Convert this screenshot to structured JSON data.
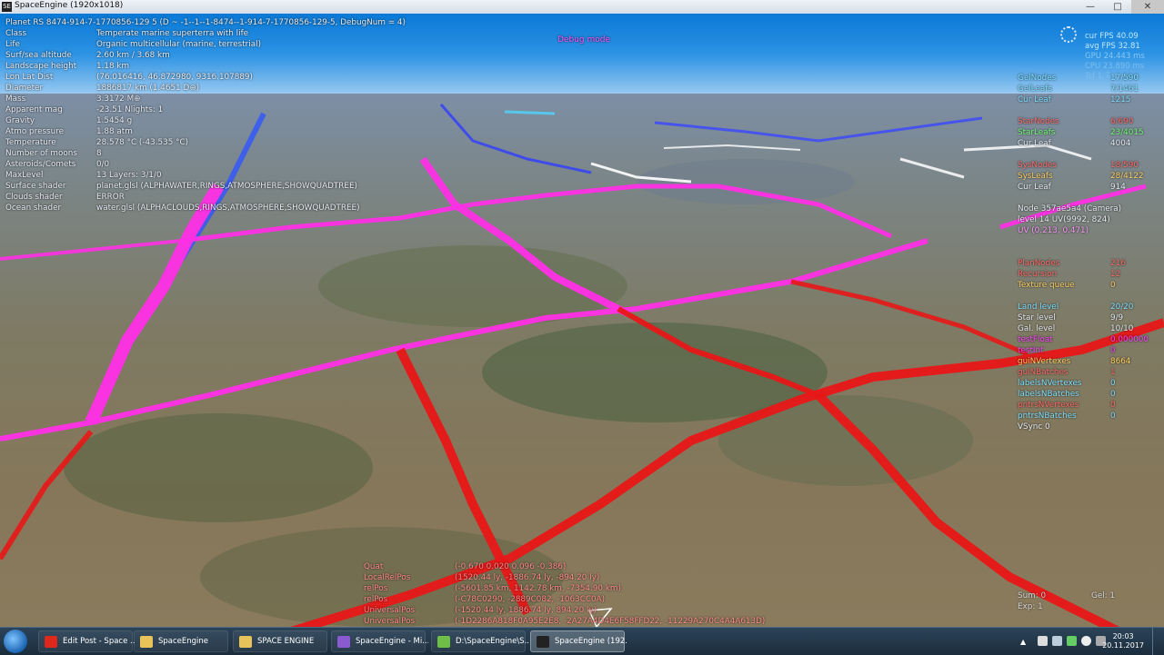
{
  "window": {
    "title": "SpaceEngine (1920x1018)",
    "app_icon": "SE"
  },
  "hud_left": {
    "planet_line": "Planet  RS 8474-914-7-1770856-129 5  (D ~ -1--1--1-8474--1-914-7-1770856-129-5, DebugNum = 4)",
    "rows": [
      {
        "label": "Class",
        "value": "Temperate marine superterra with life"
      },
      {
        "label": "Life",
        "value": "Organic multicellular (marine, terrestrial)"
      },
      {
        "label": "Surf/sea altitude",
        "value": "2.60 km / 3.68 km"
      },
      {
        "label": "Landscape height",
        "value": "1.18 km"
      },
      {
        "label": "Lon Lat Dist",
        "value": "(76.016416, 46.872980, 9316.107889)"
      },
      {
        "label": "Diameter",
        "value": "1886817 km (1.4651 D⊕)"
      },
      {
        "label": "Mass",
        "value": "3.3172 M⊕"
      },
      {
        "label": "Apparent mag",
        "value": "-23.51   Nlights: 1"
      },
      {
        "label": "Gravity",
        "value": "1.5454 g"
      },
      {
        "label": "Atmo pressure",
        "value": "1.88 atm"
      },
      {
        "label": "Temperature",
        "value": "28.578 °C (-43.535 °C)"
      },
      {
        "label": "Number of moons",
        "value": "8"
      },
      {
        "label": "Asteroids/Comets",
        "value": "0/0"
      },
      {
        "label": "MaxLevel",
        "value": "13   Layers: 3/1/0"
      },
      {
        "label": "Surface shader",
        "value": "planet.glsl (ALPHAWATER,RINGS,ATMOSPHERE,SHOWQUADTREE)"
      },
      {
        "label": "Clouds shader",
        "value": "ERROR"
      },
      {
        "label": "Ocean shader",
        "value": "water.glsl (ALPHACLOUDS,RINGS,ATMOSPHERE,SHOWQUADTREE)"
      }
    ]
  },
  "debug_label": "Debug mode",
  "fps": {
    "lines": [
      "cur FPS 40.09",
      "avg FPS 32.81",
      "GPU 24.443 ms",
      "CPU 23.890 ms",
      "Tsf 1.7 ms"
    ]
  },
  "hud_right": {
    "group1": [
      {
        "label": "GelNodes",
        "value": "17/590",
        "color": "#7fe0ff"
      },
      {
        "label": "GelLeafs",
        "value": "7/1461",
        "color": "#7fe0ff"
      },
      {
        "label": "Cur Leaf",
        "value": "1215",
        "color": "#7fe0ff"
      }
    ],
    "group2": [
      {
        "label": "StarNodes",
        "value": "6/690",
        "color": "#ff6a6a"
      },
      {
        "label": "StarLeafs",
        "value": "23/4015",
        "color": "#76ff76"
      },
      {
        "label": "Cur Leaf",
        "value": "4004",
        "color": "#e8ecf4"
      }
    ],
    "group3": [
      {
        "label": "SysNodes",
        "value": "18/590",
        "color": "#ff6a6a"
      },
      {
        "label": "SysLeafs",
        "value": "28/4122",
        "color": "#ffd166"
      },
      {
        "label": "Cur Leaf",
        "value": "914",
        "color": "#e8ecf4"
      }
    ],
    "node_info": [
      "Node 357ae5a4 (Camera)",
      "level 14 UV(9992, 824)",
      "UV (0.213, 0.471)"
    ],
    "group4": [
      {
        "label": "PlanNodes",
        "value": "216",
        "color": "#ff6a6a"
      },
      {
        "label": "Recursion",
        "value": "12",
        "color": "#ff6a6a"
      },
      {
        "label": "Texture queue",
        "value": "0",
        "color": "#ffd166"
      }
    ],
    "group5": [
      {
        "label": "Land level",
        "value": "20/20",
        "color": "#7fe0ff"
      },
      {
        "label": "Star level",
        "value": "9/9",
        "color": "#e8ecf4"
      },
      {
        "label": "Gal. level",
        "value": "10/10",
        "color": "#e8ecf4"
      },
      {
        "label": "testFloat",
        "value": "0.000000",
        "color": "#ff44ff"
      },
      {
        "label": "testInt",
        "value": "0",
        "color": "#ff44ff"
      },
      {
        "label": "guiNVertexes",
        "value": "8664",
        "color": "#ffd166"
      },
      {
        "label": "guiNBatches",
        "value": "1",
        "color": "#ff6a6a"
      },
      {
        "label": "labelsNVertexes",
        "value": "0",
        "color": "#7fe0ff"
      },
      {
        "label": "labelsNBatches",
        "value": "0",
        "color": "#7fe0ff"
      },
      {
        "label": "pntrsNVertexes",
        "value": "0",
        "color": "#ff6a6a"
      },
      {
        "label": "pntrsNBatches",
        "value": "0",
        "color": "#7fe0ff"
      }
    ],
    "vsync": "VSync 0"
  },
  "hud_bottom": {
    "rows": [
      {
        "label": "Quat",
        "value": "(-0.670  0.020  0.096  -0.386)"
      },
      {
        "label": "LocalRelPos",
        "value": "(1520.44 ly, -1886.74 ly, -894.20 ly)"
      },
      {
        "label": "relPos",
        "value": "(-5601.85 km, 1142.78 km, -7354.90 km)"
      },
      {
        "label": "relPos",
        "value": "(-C78C0290, -2889C082, -1063CC0A)"
      },
      {
        "label": "UniversalPos",
        "value": "(-1520.44 ly, 1886.74 ly, 894.20 ly)"
      },
      {
        "label": "UniversalPos",
        "value": "(-1D2286A818F0A95E2E8, -2A27A4D4E6F58FFD22, -11229A270C4A4A613D)"
      }
    ],
    "sum": "Sum: 0",
    "exp": "Exp: 1",
    "gel": "Gel: 1"
  },
  "taskbar": {
    "items": [
      {
        "label": "Edit Post - Space ...",
        "icon": "opera-icon",
        "color": "#e0271b"
      },
      {
        "label": "SpaceEngine",
        "icon": "folder-icon",
        "color": "#e8c35a"
      },
      {
        "label": "SPACE ENGINE",
        "icon": "folder-icon",
        "color": "#e8c35a"
      },
      {
        "label": "SpaceEngine - Mi...",
        "icon": "visual-studio-icon",
        "color": "#8a5bd0"
      },
      {
        "label": "D:\\SpaceEngine\\S...",
        "icon": "notepad-icon",
        "color": "#6fbe48"
      },
      {
        "label": "SpaceEngine (192...",
        "icon": "spaceengine-icon",
        "color": "#222222"
      }
    ],
    "time": "20:03",
    "date": "20.11.2017"
  }
}
